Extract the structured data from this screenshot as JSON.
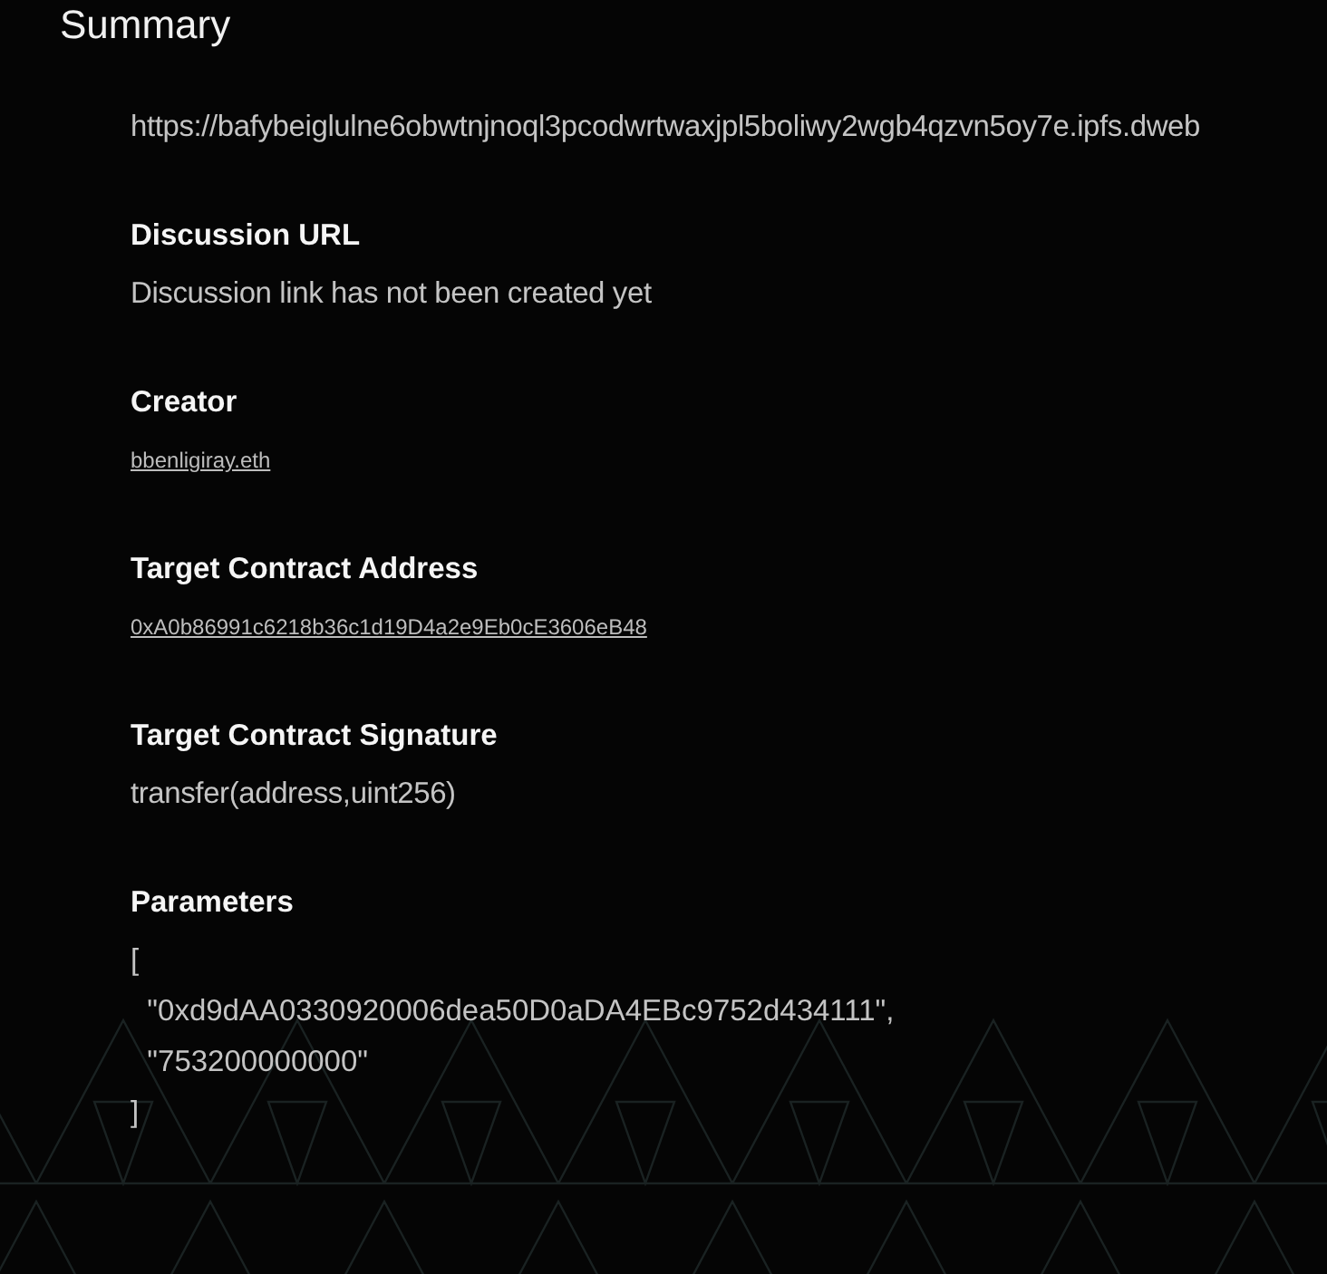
{
  "title": "Summary",
  "sections": [
    {
      "kind": "text",
      "value": "https://bafybeiglulne6obwtnjnoql3pcodwrtwaxjpl5boliwy2wgb4qzvn5oy7e.ipfs.dweb"
    },
    {
      "heading": "Discussion URL",
      "kind": "text",
      "value": "Discussion link has not been created yet"
    },
    {
      "heading": "Creator",
      "kind": "link",
      "value": "bbenligiray.eth"
    },
    {
      "heading": "Target Contract Address",
      "kind": "link",
      "value": "0xA0b86991c6218b36c1d19D4a2e9Eb0cE3606eB48"
    },
    {
      "heading": "Target Contract Signature",
      "kind": "text",
      "value": "transfer(address,uint256)"
    },
    {
      "heading": "Parameters",
      "kind": "lines",
      "lines": [
        "[",
        "  \"0xd9dAA0330920006dea50D0aDA4EBc9752d434111\",",
        "  \"753200000000\"",
        "]"
      ]
    }
  ]
}
